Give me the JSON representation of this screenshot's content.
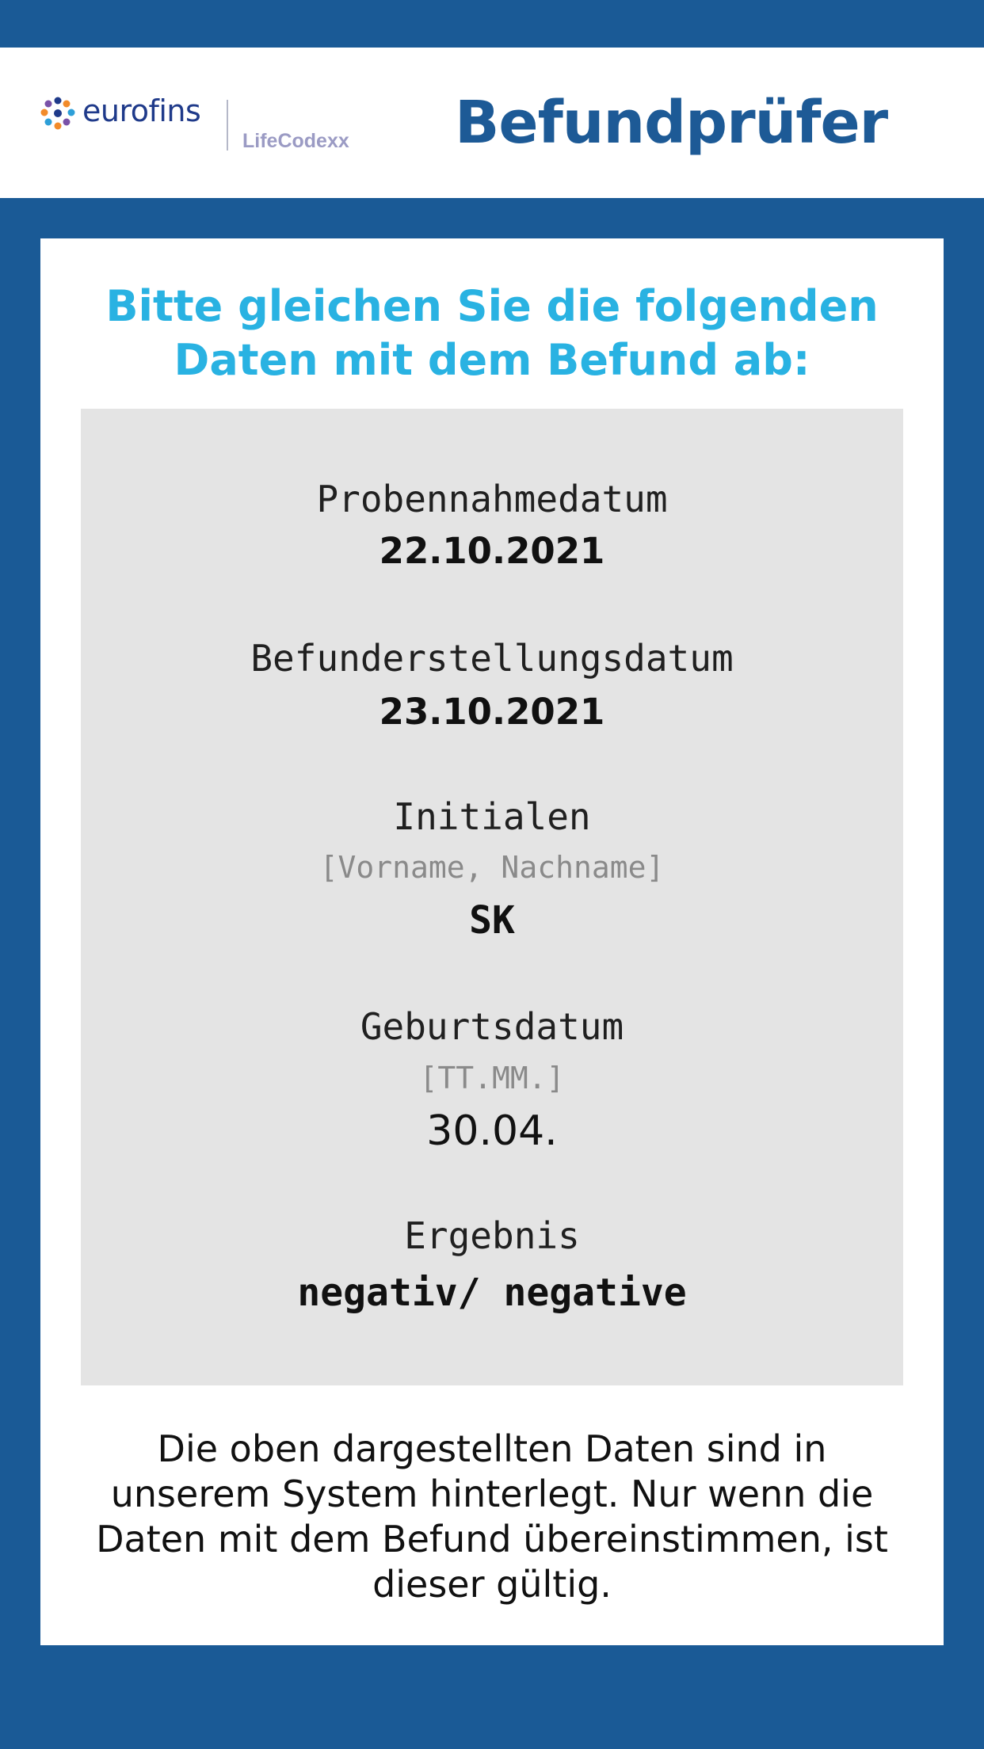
{
  "header": {
    "logo": {
      "wordmark": "eurofins",
      "subbrand": "LifeCodexx",
      "icon": "eurofins-dots-icon",
      "colors": [
        "#1f3a8a",
        "#f28b2a",
        "#2e9fd8",
        "#7a52a8"
      ]
    },
    "title": "Befundprüfer"
  },
  "card": {
    "instruction": [
      "Bitte gleichen Sie die folgenden",
      "Daten mit dem Befund ab:"
    ],
    "fields": [
      {
        "label": "Probennahmedatum",
        "value": "22.10.2021"
      },
      {
        "label": "Befunderstellungsdatum",
        "value": "23.10.2021"
      },
      {
        "label": "Initialen",
        "hint": "[Vorname, Nachname]",
        "value": "SK"
      },
      {
        "label": "Geburtsdatum",
        "hint": "[TT.MM.]",
        "value": "30.04."
      },
      {
        "label": "Ergebnis",
        "value": "negativ/ negative"
      }
    ],
    "note": [
      "Die oben dargestellten Daten sind in",
      "unserem System hinterlegt. Nur wenn die",
      "Daten mit dem Befund übereinstimmen, ist",
      "dieser gültig."
    ]
  },
  "colors": {
    "background": "#1a5a96",
    "title": "#1d5a96",
    "accent": "#29b2e2",
    "panel": "#e4e4e4"
  }
}
